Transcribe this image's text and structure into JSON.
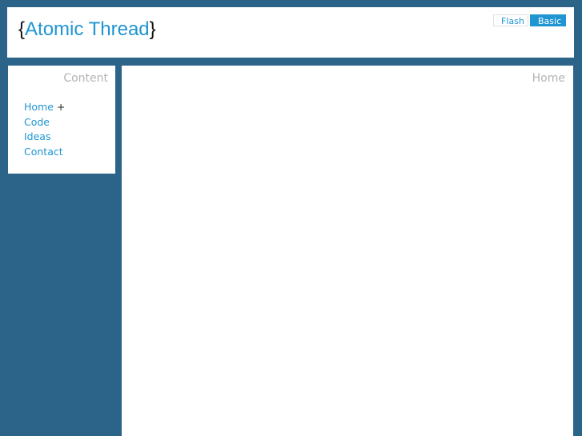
{
  "site": {
    "brace_open": "{",
    "name": "Atomic Thread",
    "brace_close": "}"
  },
  "mode_switch": {
    "flash_label": "Flash",
    "basic_label": "Basic",
    "selected": "Basic"
  },
  "sidebar": {
    "heading": "Content",
    "items": [
      {
        "label": "Home",
        "marker": "+"
      },
      {
        "label": "Code"
      },
      {
        "label": "Ideas"
      },
      {
        "label": "Contact"
      }
    ]
  },
  "main": {
    "heading": "Home"
  },
  "colors": {
    "background": "#2b6488",
    "accent": "#1f95d2",
    "panel": "#ffffff",
    "heading_gray": "#b3b3b3"
  }
}
